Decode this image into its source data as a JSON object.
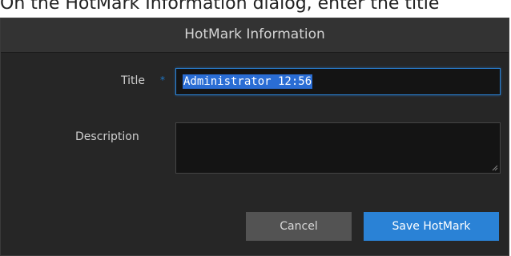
{
  "document": {
    "intro_text": "On the HotMark Information dialog, enter the title"
  },
  "dialog": {
    "title": "HotMark Information",
    "fields": {
      "title_label": "Title",
      "required_marker": "*",
      "title_value": "Administrator 12:56",
      "description_label": "Description",
      "description_value": ""
    },
    "buttons": {
      "cancel_label": "Cancel",
      "save_label": "Save HotMark"
    }
  },
  "colors": {
    "accent": "#2a82d6",
    "dialog_bg": "#262626",
    "header_bg": "#333333"
  }
}
